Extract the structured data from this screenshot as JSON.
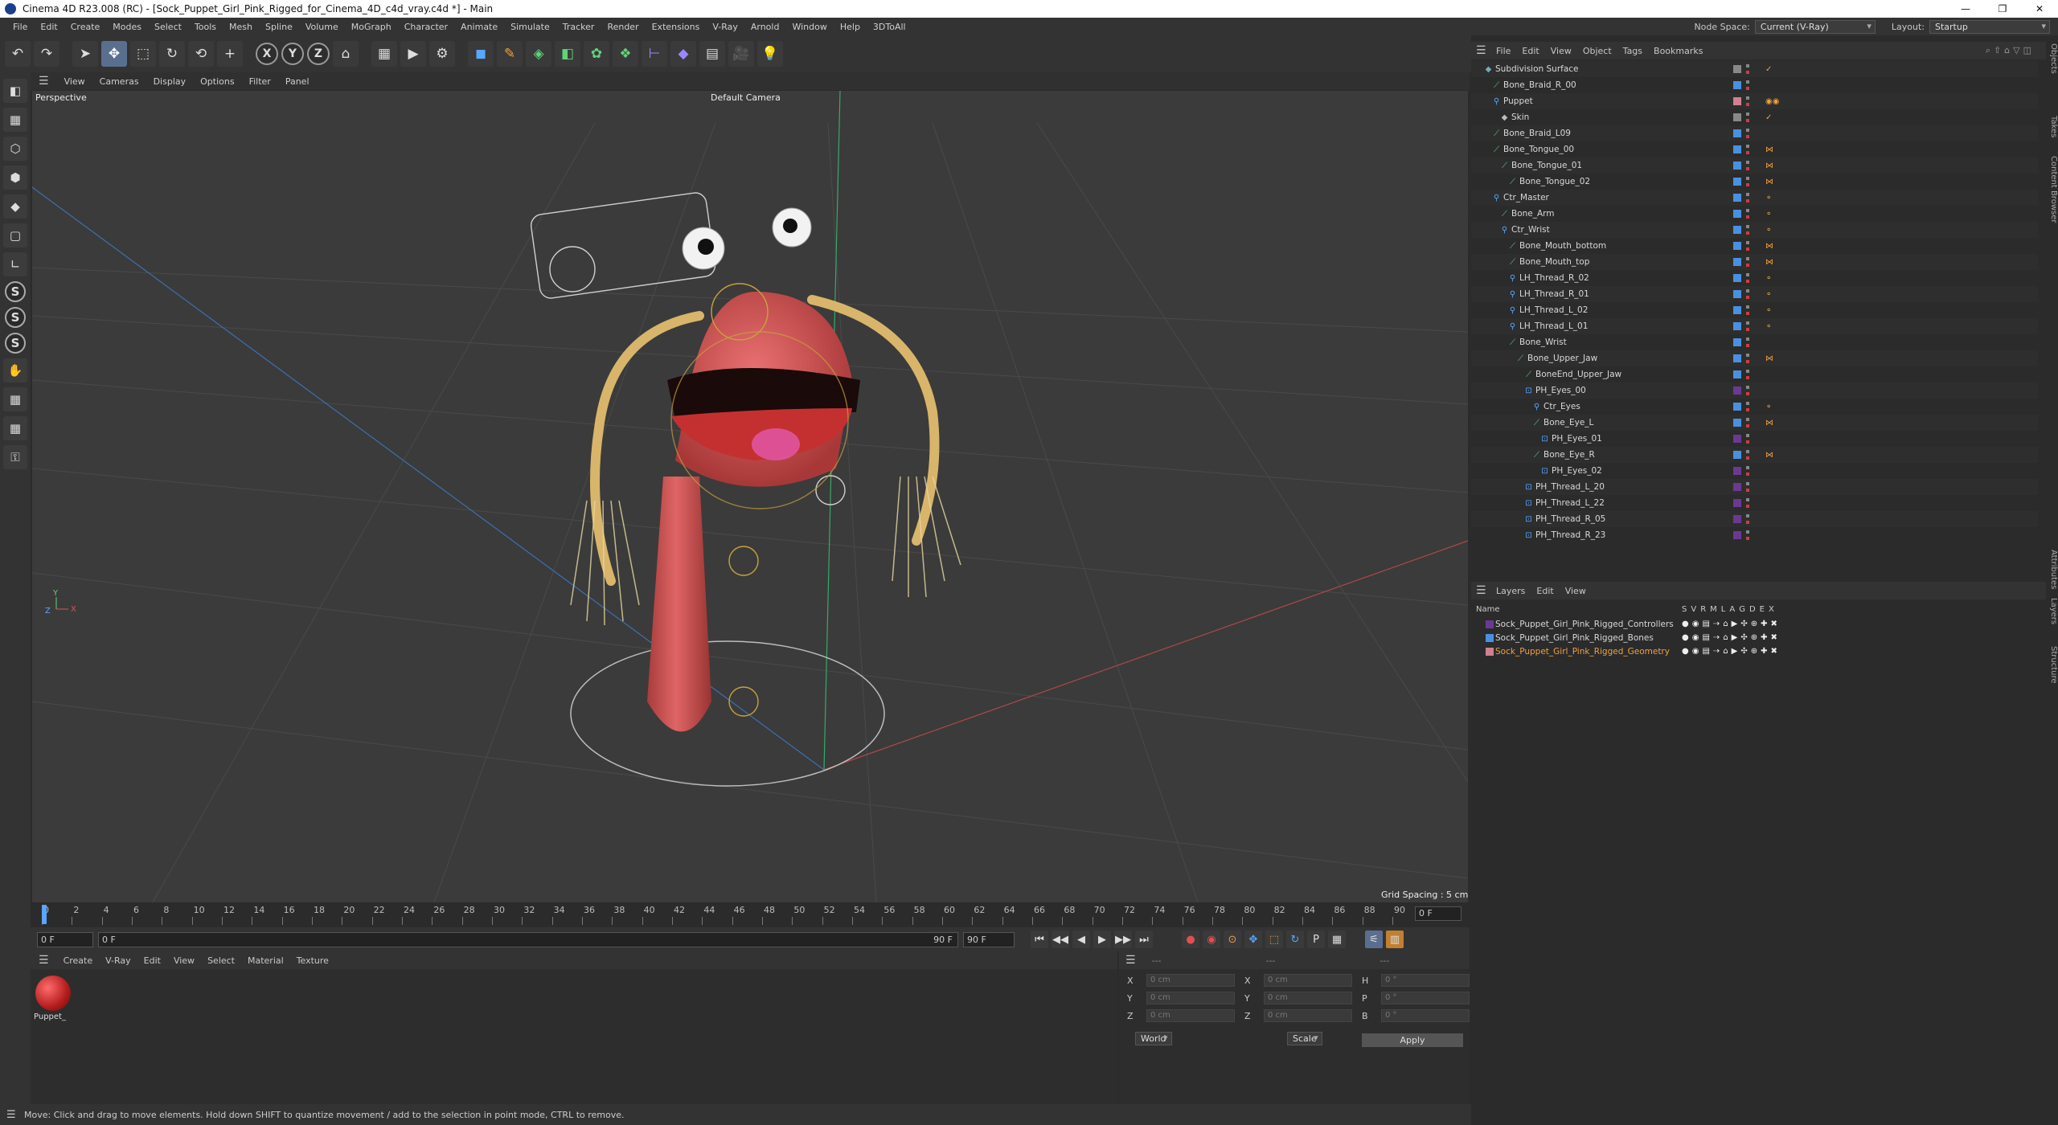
{
  "window": {
    "title": "Cinema 4D R23.008 (RC) - [Sock_Puppet_Girl_Pink_Rigged_for_Cinema_4D_c4d_vray.c4d *] - Main",
    "controls": [
      "—",
      "❐",
      "✕"
    ]
  },
  "menubar": {
    "items": [
      "File",
      "Edit",
      "Create",
      "Modes",
      "Select",
      "Tools",
      "Mesh",
      "Spline",
      "Volume",
      "MoGraph",
      "Character",
      "Animate",
      "Simulate",
      "Tracker",
      "Render",
      "Extensions",
      "V-Ray",
      "Arnold",
      "Window",
      "Help",
      "3DToAll"
    ],
    "node_space_label": "Node Space:",
    "node_space_value": "Current (V-Ray)",
    "layout_label": "Layout:",
    "layout_value": "Startup"
  },
  "toolbar": {
    "icons": [
      "undo-icon",
      "redo-icon",
      "select-icon",
      "move-icon",
      "scale-icon",
      "rotate-icon",
      "recent-icon",
      "add-icon",
      "x-axis-icon",
      "y-axis-icon",
      "z-axis-icon",
      "coord-icon",
      "render-region-icon",
      "render-view-icon",
      "render-settings-icon",
      "cube-icon",
      "pen-icon",
      "subdivide-icon",
      "extrude-icon",
      "cloner-icon",
      "mograph-icon",
      "deformer-icon",
      "field-icon",
      "floor-icon",
      "camera-icon",
      "light-icon"
    ],
    "glyphs": [
      "↶",
      "↷",
      "➤",
      "✥",
      "⬚",
      "↻",
      "⟲",
      "+",
      "X",
      "Y",
      "Z",
      "⌂",
      "▦",
      "▶",
      "⚙",
      "◼",
      "✎",
      "◈",
      "◧",
      "✿",
      "❖",
      "⊢",
      "◆",
      "▤",
      "🎥",
      "💡"
    ],
    "xyz": [
      "X",
      "Y",
      "Z"
    ]
  },
  "left_tools": {
    "icons": [
      "model-mode-icon",
      "texture-mode-icon",
      "points-icon",
      "edges-icon",
      "polygons-icon",
      "uv-icon",
      "axis-icon",
      "snap-icon",
      "snap-settings-icon",
      "solo-icon",
      "paint-icon",
      "grid-icon",
      "workplane-icon",
      "lock-icon"
    ],
    "glyphs": [
      "◧",
      "▦",
      "⬡",
      "⬢",
      "◆",
      "▢",
      "∟",
      "S",
      "S",
      "S",
      "✋",
      "▦",
      "▦",
      "⚿"
    ]
  },
  "viewport": {
    "menu": [
      "View",
      "Cameras",
      "Display",
      "Options",
      "Filter",
      "Panel"
    ],
    "label": "Perspective",
    "camera": "Default Camera",
    "grid_spacing": "Grid Spacing : 5 cm"
  },
  "timeline": {
    "ticks": [
      "0",
      "2",
      "4",
      "6",
      "8",
      "10",
      "12",
      "14",
      "16",
      "18",
      "20",
      "22",
      "24",
      "26",
      "28",
      "30",
      "32",
      "34",
      "36",
      "38",
      "40",
      "42",
      "44",
      "46",
      "48",
      "50",
      "52",
      "54",
      "56",
      "58",
      "60",
      "62",
      "64",
      "66",
      "68",
      "70",
      "72",
      "74",
      "76",
      "78",
      "80",
      "82",
      "84",
      "86",
      "88",
      "90"
    ],
    "current_frame": "0 F"
  },
  "transport": {
    "start": "0 F",
    "preview_start": "0 F",
    "preview_end": "90 F",
    "end": "90 F",
    "buttons": [
      "⏮",
      "◀◀",
      "◀",
      "▶",
      "▶▶",
      "⏭"
    ]
  },
  "materials": {
    "menu": [
      "Create",
      "V-Ray",
      "Edit",
      "View",
      "Select",
      "Material",
      "Texture"
    ],
    "items": [
      {
        "name": "Puppet_"
      }
    ]
  },
  "attributes": {
    "header": [
      "---",
      "---",
      "---"
    ],
    "rows": [
      {
        "a": "X",
        "av": "0 cm",
        "b": "X",
        "bv": "0 cm",
        "c": "H",
        "cv": "0 °"
      },
      {
        "a": "Y",
        "av": "0 cm",
        "b": "Y",
        "bv": "0 cm",
        "c": "P",
        "cv": "0 °"
      },
      {
        "a": "Z",
        "av": "0 cm",
        "b": "Z",
        "bv": "0 cm",
        "c": "B",
        "cv": "0 °"
      }
    ],
    "coord_system": "World",
    "mode": "Scale",
    "apply": "Apply"
  },
  "status": "Move: Click and drag to move elements. Hold down SHIFT to quantize movement / add to the selection in point mode, CTRL to remove.",
  "objects_panel": {
    "menu": [
      "File",
      "Edit",
      "View",
      "Object",
      "Tags",
      "Bookmarks"
    ],
    "rows": [
      {
        "name": "Subdivision Surface",
        "depth": 0,
        "color": "#888888",
        "tag": "✓"
      },
      {
        "name": "Bone_Braid_R_00",
        "depth": 1,
        "color": "#4a90e0",
        "tag": ""
      },
      {
        "name": "Puppet",
        "depth": 1,
        "color": "#d08090",
        "tag": "◉◉"
      },
      {
        "name": "Skin",
        "depth": 2,
        "color": "#888888",
        "tag": "✓"
      },
      {
        "name": "Bone_Braid_L09",
        "depth": 1,
        "color": "#4a90e0",
        "tag": ""
      },
      {
        "name": "Bone_Tongue_00",
        "depth": 1,
        "color": "#4a90e0",
        "tag": "⋈"
      },
      {
        "name": "Bone_Tongue_01",
        "depth": 2,
        "color": "#4a90e0",
        "tag": "⋈"
      },
      {
        "name": "Bone_Tongue_02",
        "depth": 3,
        "color": "#4a90e0",
        "tag": "⋈"
      },
      {
        "name": "Ctr_Master",
        "depth": 1,
        "color": "#4a90e0",
        "tag": "⚬"
      },
      {
        "name": "Bone_Arm",
        "depth": 2,
        "color": "#4a90e0",
        "tag": "⚬"
      },
      {
        "name": "Ctr_Wrist",
        "depth": 2,
        "color": "#4a90e0",
        "tag": "⚬"
      },
      {
        "name": "Bone_Mouth_bottom",
        "depth": 3,
        "color": "#4a90e0",
        "tag": "⋈"
      },
      {
        "name": "Bone_Mouth_top",
        "depth": 3,
        "color": "#4a90e0",
        "tag": "⋈"
      },
      {
        "name": "LH_Thread_R_02",
        "depth": 3,
        "color": "#4a90e0",
        "tag": "⚬"
      },
      {
        "name": "LH_Thread_R_01",
        "depth": 3,
        "color": "#4a90e0",
        "tag": "⚬"
      },
      {
        "name": "LH_Thread_L_02",
        "depth": 3,
        "color": "#4a90e0",
        "tag": "⚬"
      },
      {
        "name": "LH_Thread_L_01",
        "depth": 3,
        "color": "#4a90e0",
        "tag": "⚬"
      },
      {
        "name": "Bone_Wrist",
        "depth": 3,
        "color": "#4a90e0",
        "tag": ""
      },
      {
        "name": "Bone_Upper_Jaw",
        "depth": 4,
        "color": "#4a90e0",
        "tag": "⋈"
      },
      {
        "name": "BoneEnd_Upper_Jaw",
        "depth": 5,
        "color": "#4a90e0",
        "tag": ""
      },
      {
        "name": "PH_Eyes_00",
        "depth": 5,
        "color": "#6a3a90",
        "tag": ""
      },
      {
        "name": "Ctr_Eyes",
        "depth": 6,
        "color": "#4a90e0",
        "tag": "⚬"
      },
      {
        "name": "Bone_Eye_L",
        "depth": 6,
        "color": "#4a90e0",
        "tag": "⋈"
      },
      {
        "name": "PH_Eyes_01",
        "depth": 7,
        "color": "#6a3a90",
        "tag": ""
      },
      {
        "name": "Bone_Eye_R",
        "depth": 6,
        "color": "#4a90e0",
        "tag": "⋈"
      },
      {
        "name": "PH_Eyes_02",
        "depth": 7,
        "color": "#6a3a90",
        "tag": ""
      },
      {
        "name": "PH_Thread_L_20",
        "depth": 5,
        "color": "#6a3a90",
        "tag": ""
      },
      {
        "name": "PH_Thread_L_22",
        "depth": 5,
        "color": "#6a3a90",
        "tag": ""
      },
      {
        "name": "PH_Thread_R_05",
        "depth": 5,
        "color": "#6a3a90",
        "tag": ""
      },
      {
        "name": "PH_Thread_R_23",
        "depth": 5,
        "color": "#6a3a90",
        "tag": ""
      }
    ]
  },
  "layers_panel": {
    "menu": [
      "Layers",
      "Edit",
      "View"
    ],
    "name_header": "Name",
    "col_headers": [
      "S",
      "V",
      "R",
      "M",
      "L",
      "A",
      "G",
      "D",
      "E",
      "X"
    ],
    "rows": [
      {
        "name": "Sock_Puppet_Girl_Pink_Rigged_Controllers",
        "color": "#6a3a90",
        "highlight": false
      },
      {
        "name": "Sock_Puppet_Girl_Pink_Rigged_Bones",
        "color": "#4a90e0",
        "highlight": false
      },
      {
        "name": "Sock_Puppet_Girl_Pink_Rigged_Geometry",
        "color": "#d08090",
        "highlight": true
      }
    ],
    "icons": [
      "●",
      "◉",
      "▤",
      "⇢",
      "⌂",
      "▶",
      "✣",
      "⊕",
      "✚",
      "✖"
    ]
  },
  "side_tabs": [
    "Objects",
    "Takes",
    "Content Browser",
    "Attributes",
    "Layers",
    "Structure"
  ]
}
